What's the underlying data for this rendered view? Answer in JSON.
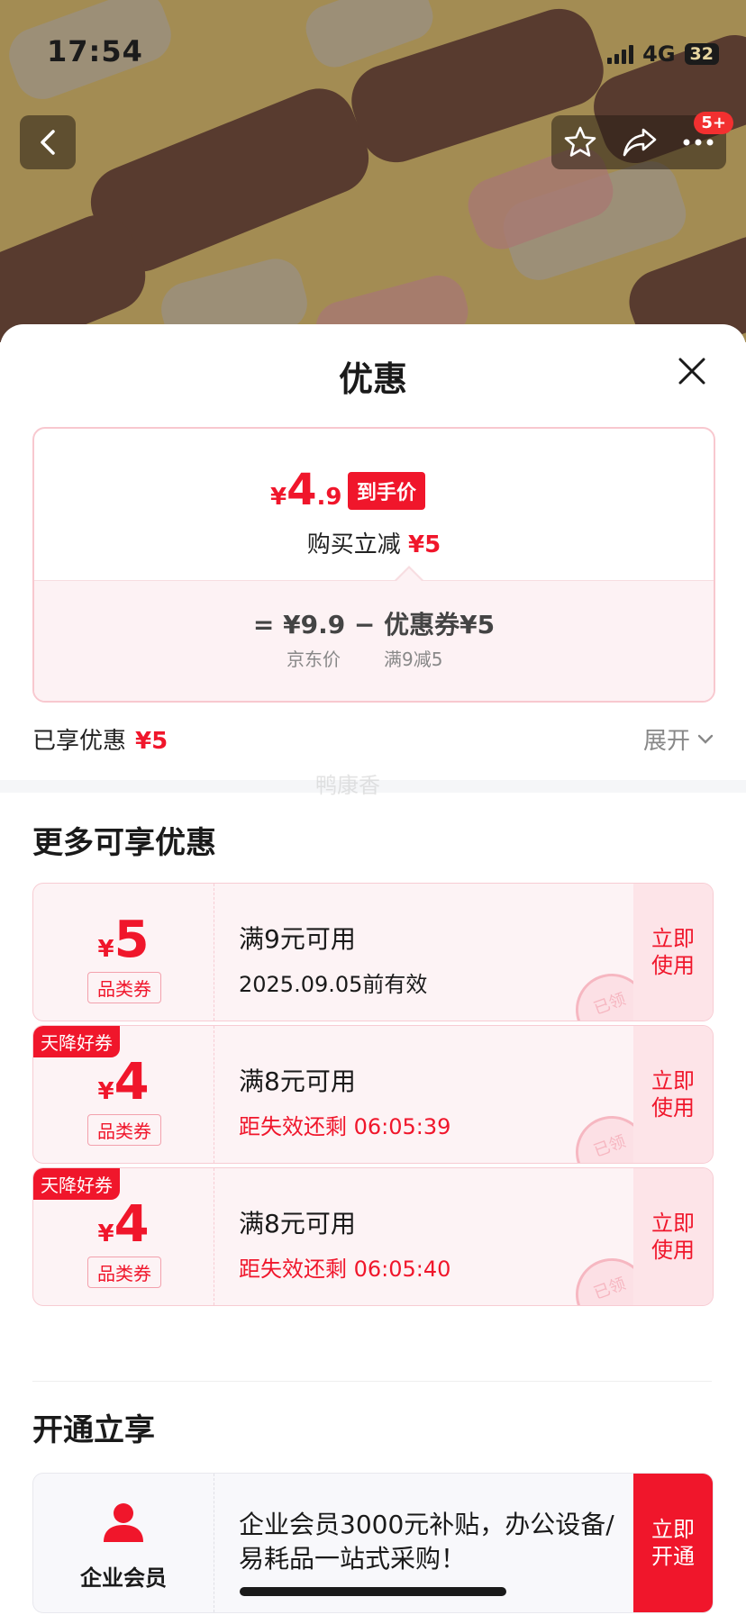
{
  "status_bar": {
    "time": "17:54",
    "network": "4G",
    "battery": "32"
  },
  "nav": {
    "badge": "5+"
  },
  "sheet": {
    "title": "优惠"
  },
  "summary": {
    "currency": "¥",
    "final_price_int": "4",
    "final_price_dec": ".9",
    "final_tag": "到手价",
    "reduce_label": "购买立减",
    "reduce_amount": "¥5",
    "equation": "=  ¥9.9  −  优惠券¥5",
    "jd_price_label": "京东价",
    "coupon_condition": "满9减5"
  },
  "enjoyed": {
    "label": "已享优惠",
    "amount": "¥5",
    "expand": "展开"
  },
  "watermark": "鸭康香",
  "more_section": {
    "title": "更多可享优惠"
  },
  "coupons": [
    {
      "currency": "¥",
      "amount": "5",
      "category": "品类券",
      "tag": "",
      "condition": "满9元可用",
      "validity": "2025.09.05前有效",
      "use": "立即使用",
      "stamp": "已领"
    },
    {
      "currency": "¥",
      "amount": "4",
      "category": "品类券",
      "tag": "天降好券",
      "condition": "满8元可用",
      "validity": "距失效还剩 06:05:39",
      "use": "立即使用",
      "stamp": "已领"
    },
    {
      "currency": "¥",
      "amount": "4",
      "category": "品类券",
      "tag": "天降好券",
      "condition": "满8元可用",
      "validity": "距失效还剩 06:05:40",
      "use": "立即使用",
      "stamp": "已领"
    }
  ],
  "member_section": {
    "title": "开通立享"
  },
  "member": {
    "label": "企业会员",
    "text": "企业会员3000元补贴，办公设备/易耗品一站式采购！",
    "button": "立即开通"
  },
  "colors": {
    "accent": "#f0162b",
    "coupon_bg": "#fdf3f5",
    "coupon_border": "#f7ccd3"
  },
  "icons": [
    "back-icon",
    "star-icon",
    "share-icon",
    "more-icon",
    "close-icon",
    "chevron-down-icon",
    "member-icon"
  ]
}
